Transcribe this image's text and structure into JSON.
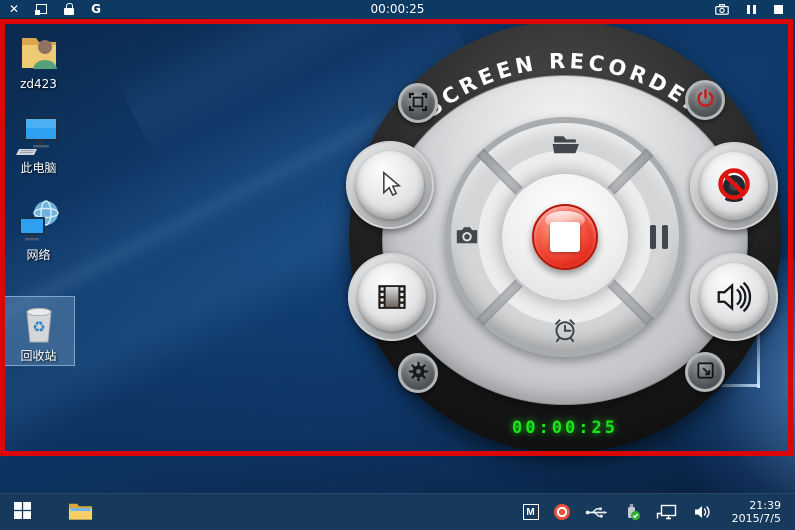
{
  "topbar": {
    "timer": "00:00:25",
    "g_label": "G"
  },
  "recorder": {
    "title": "SCREEN RECORDER",
    "timer": "00:00:25",
    "icons": {
      "top_left": "region-select",
      "top_right": "power",
      "left": "mouse-cursor",
      "right": "webcam-muted",
      "bottom_left_large": "film",
      "bottom_left_small": "settings-gear",
      "bottom_right_large": "speaker",
      "bottom_right_small": "minimize-to-window",
      "dpad_top": "open-folder",
      "dpad_left": "screenshot-camera",
      "dpad_right": "pause",
      "dpad_bottom": "scheduled-timer",
      "center": "stop-record"
    }
  },
  "desktop_icons": [
    {
      "label": "zd423",
      "selected": false
    },
    {
      "label": "此电脑",
      "selected": false
    },
    {
      "label": "网络",
      "selected": false
    },
    {
      "label": "回收站",
      "selected": true
    }
  ],
  "taskbar": {
    "tray_m": "M",
    "time": "21:39",
    "date": "2015/7/5"
  },
  "colors": {
    "recording_border": "#dc0606",
    "recorder_timer_green": "#17e619",
    "stop_button_red": "#e93322",
    "topbar_bg": "#0d3a63",
    "taskbar_bg": "#17395c",
    "wallpaper_base": "#0e3a6a"
  }
}
